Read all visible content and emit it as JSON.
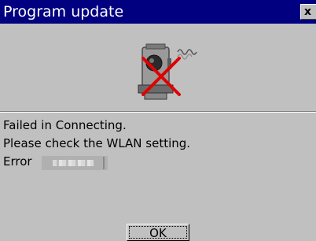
{
  "window": {
    "title": "Program update",
    "close_label": "x"
  },
  "icon": {
    "name": "instrument-wlan-failed-icon"
  },
  "message": {
    "line1": "Failed in Connecting.",
    "line2": "Please check the WLAN setting.",
    "error_label": "Error"
  },
  "buttons": {
    "ok_label": "OK"
  },
  "colors": {
    "titlebar": "#000080",
    "dialog_bg": "#c0c0c0",
    "error_mark": "#e00000"
  }
}
